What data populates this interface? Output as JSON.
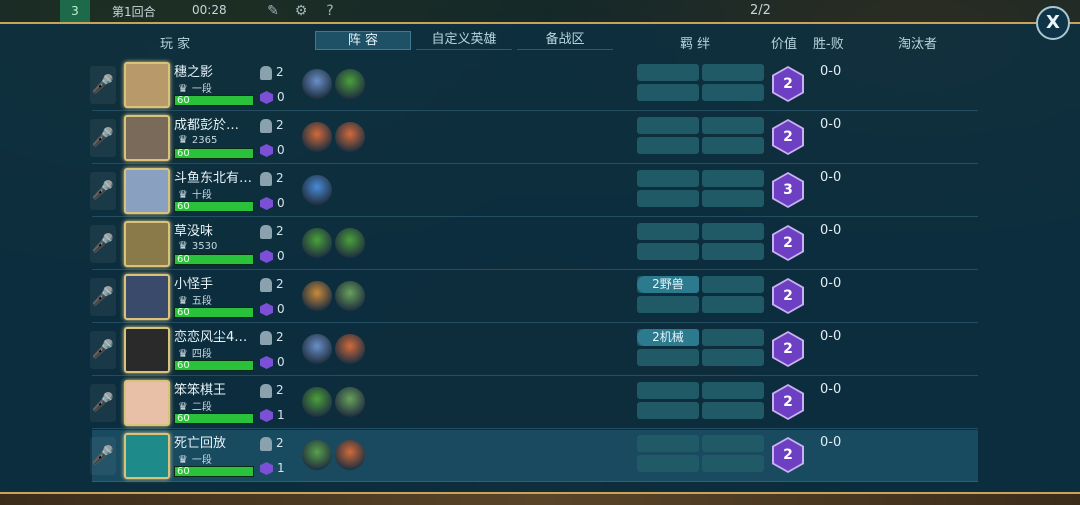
{
  "topbar": {
    "round_tag": "3",
    "round": "第1回合",
    "timer": "00:28",
    "count": "2/2"
  },
  "header": {
    "player": "玩 家",
    "tab_lineup": "阵 容",
    "tab_custom": "自定义英雄",
    "tab_bench": "备战区",
    "bond": "羁 绊",
    "value": "价值",
    "winloss": "胜-败",
    "eliminator": "淘汰者"
  },
  "close_label": "X",
  "players": [
    {
      "name": "穗之影",
      "rank": "一段",
      "level": "60",
      "helmets": "2",
      "gems": "0",
      "value": "2",
      "record": "0-0",
      "bond": "",
      "avatar_color": "#b89a6a",
      "units": [
        "#6a8fc9",
        "#4aa03a"
      ],
      "self": false
    },
    {
      "name": "成都彭於…",
      "rank": "2365",
      "level": "60",
      "helmets": "2",
      "gems": "0",
      "value": "2",
      "record": "0-0",
      "bond": "",
      "avatar_color": "#7a6a5a",
      "units": [
        "#d26a3a",
        "#d26a3a"
      ],
      "self": false
    },
    {
      "name": "斗鱼东北有…",
      "rank": "十段",
      "level": "60",
      "helmets": "2",
      "gems": "0",
      "value": "3",
      "record": "0-0",
      "bond": "",
      "avatar_color": "#8aa0c0",
      "units": [
        "#4a8ad8"
      ],
      "self": false
    },
    {
      "name": "草没味",
      "rank": "3530",
      "level": "60",
      "helmets": "2",
      "gems": "0",
      "value": "2",
      "record": "0-0",
      "bond": "",
      "avatar_color": "#8a7a4a",
      "units": [
        "#4aa03a",
        "#4aa03a"
      ],
      "self": false
    },
    {
      "name": "小怪手",
      "rank": "五段",
      "level": "60",
      "helmets": "2",
      "gems": "0",
      "value": "2",
      "record": "0-0",
      "bond": "2野兽",
      "avatar_color": "#3a4a6a",
      "units": [
        "#c98a3a",
        "#6aa05a"
      ],
      "self": false
    },
    {
      "name": "恋恋风尘4…",
      "rank": "四段",
      "level": "60",
      "helmets": "2",
      "gems": "0",
      "value": "2",
      "record": "0-0",
      "bond": "2机械",
      "avatar_color": "#2a2a2a",
      "units": [
        "#6a8fc9",
        "#d26a3a"
      ],
      "self": false
    },
    {
      "name": "笨笨棋王",
      "rank": "二段",
      "level": "60",
      "helmets": "2",
      "gems": "1",
      "value": "2",
      "record": "0-0",
      "bond": "",
      "avatar_color": "#e8c0a8",
      "units": [
        "#4aa03a",
        "#6aa05a"
      ],
      "self": false
    },
    {
      "name": "死亡回放",
      "rank": "一段",
      "level": "60",
      "helmets": "2",
      "gems": "1",
      "value": "2",
      "record": "0-0",
      "bond": "",
      "avatar_color": "#1e8a8a",
      "units": [
        "#5aa04a",
        "#d26a3a"
      ],
      "self": true
    }
  ]
}
